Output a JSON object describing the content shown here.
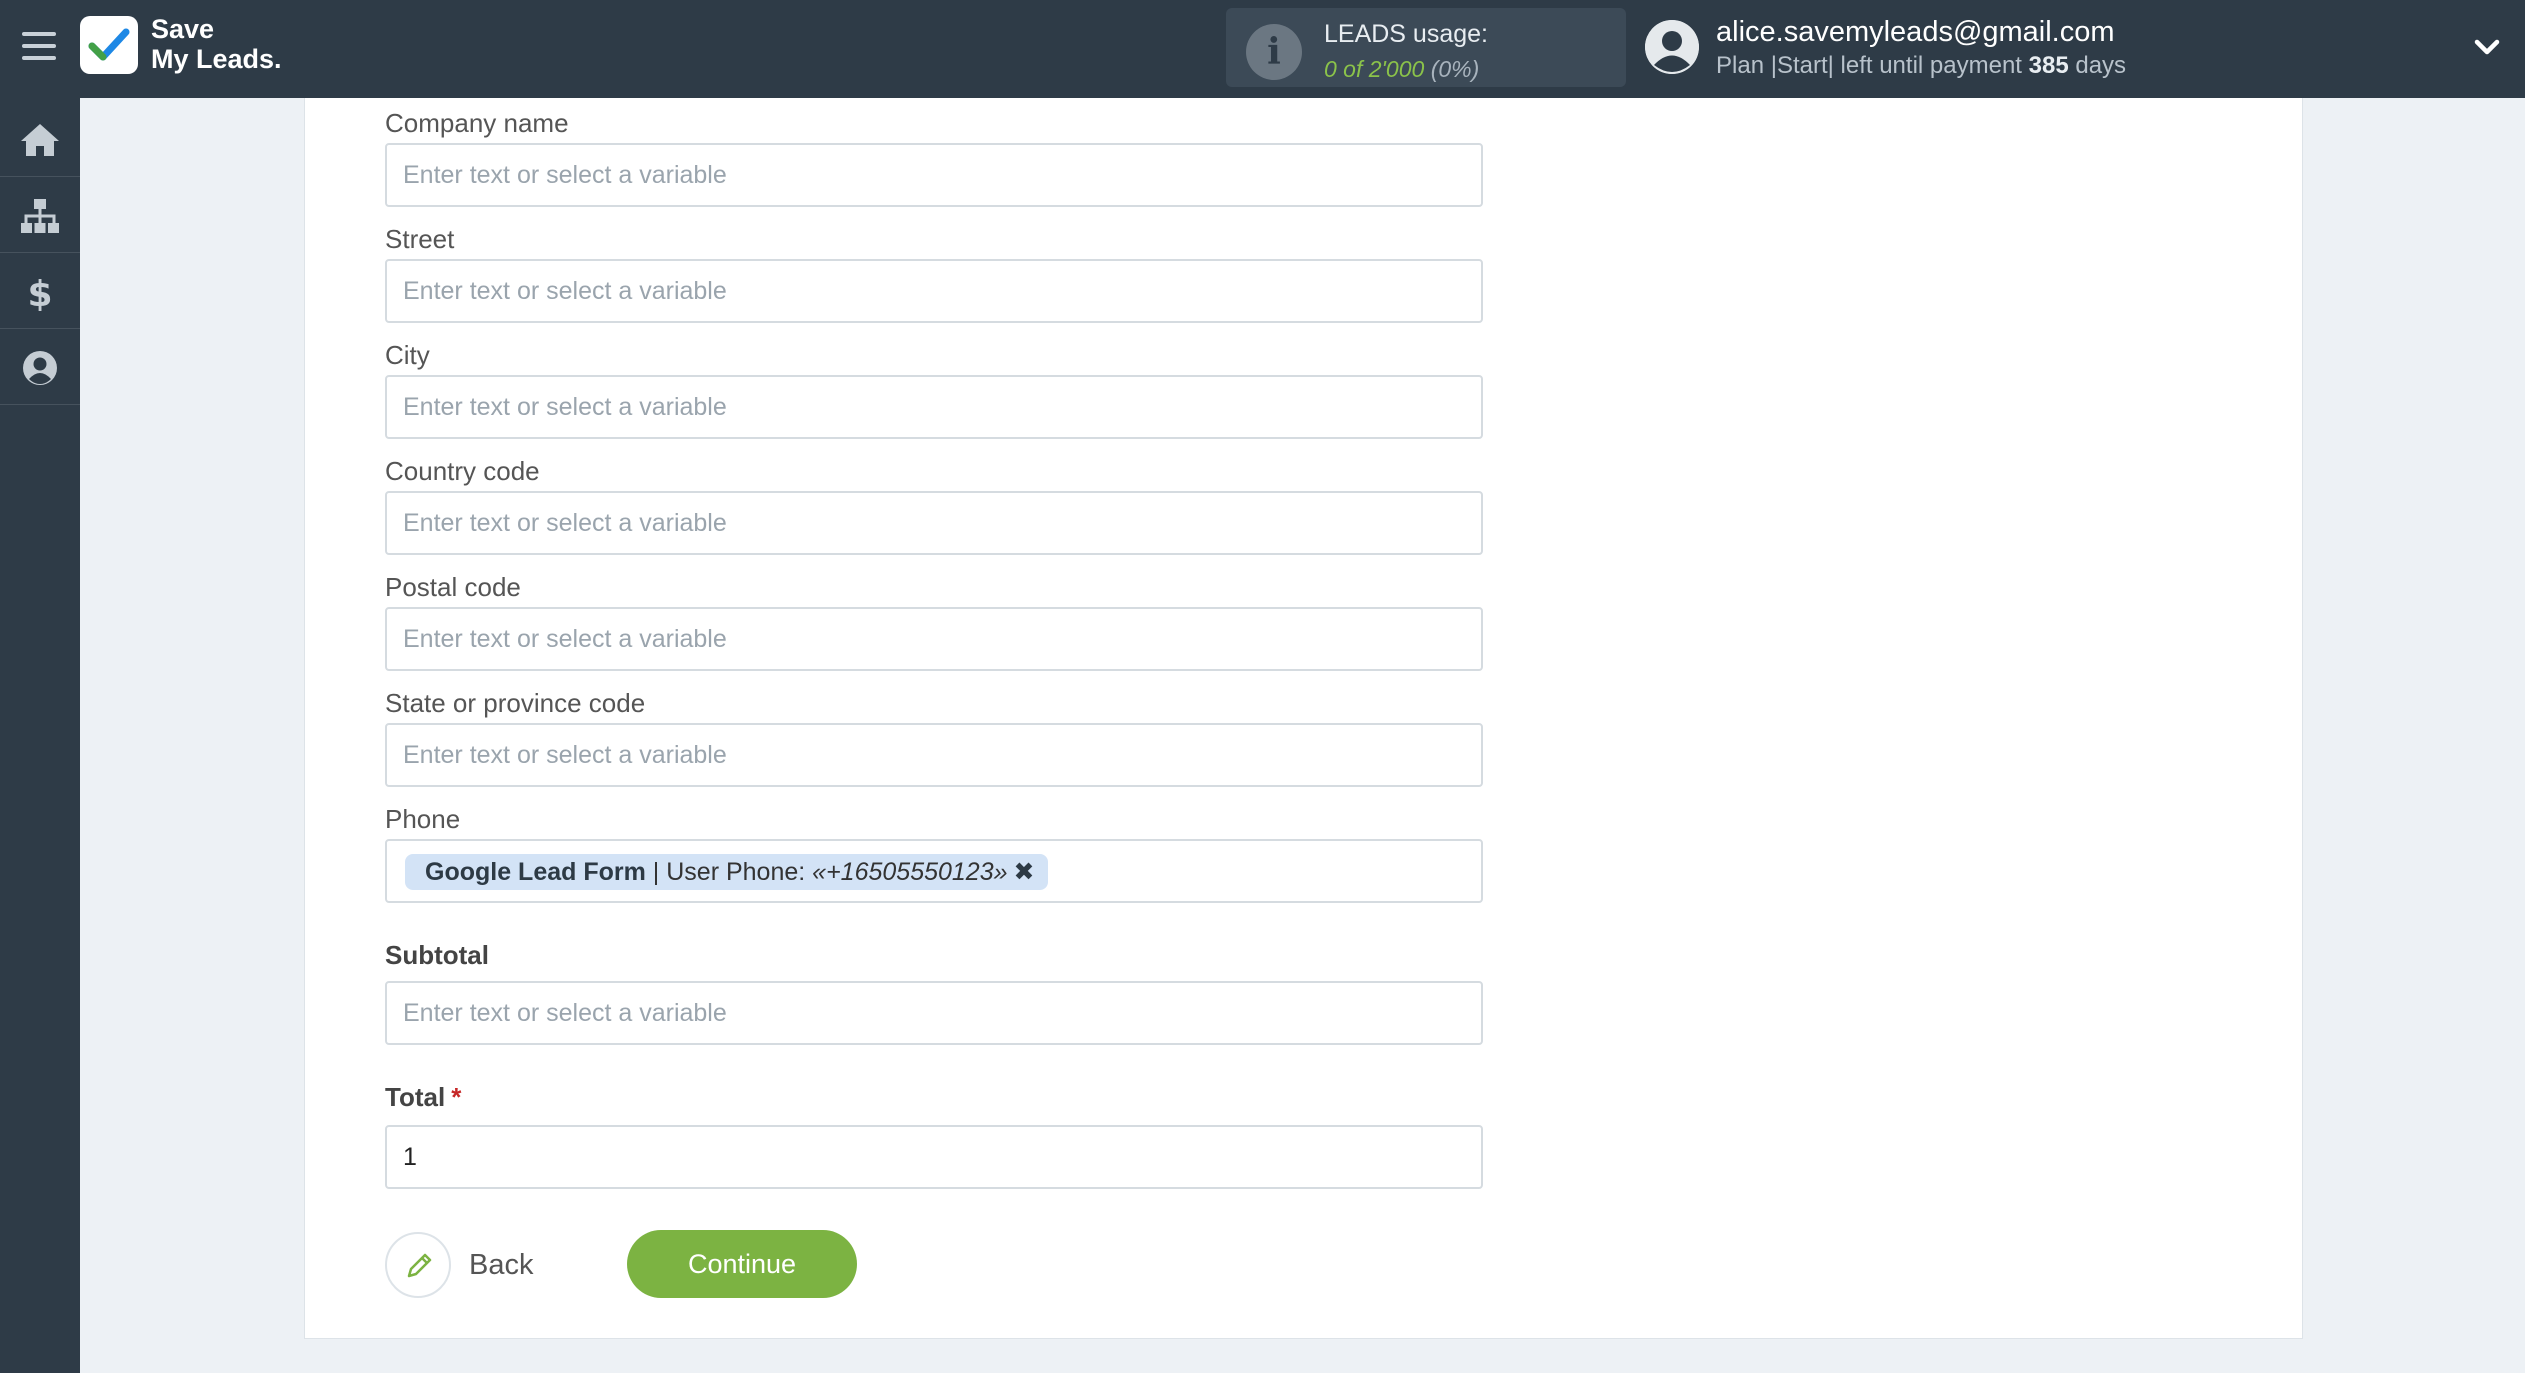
{
  "header": {
    "logo_line1": "Save",
    "logo_line2": "My Leads.",
    "usage_title": "LEADS usage:",
    "usage_value": "0 of 2'000",
    "usage_percent": "(0%)",
    "user_email": "alice.savemyleads@gmail.com",
    "plan_prefix": "Plan |Start| left until payment",
    "plan_days": "385",
    "plan_suffix": "days"
  },
  "sidebar": {
    "items": [
      {
        "icon": "home-icon"
      },
      {
        "icon": "sitemap-icon"
      },
      {
        "icon": "dollar-icon"
      },
      {
        "icon": "user-circle-icon"
      }
    ]
  },
  "form": {
    "placeholder": "Enter text or select a variable",
    "fields": [
      {
        "label": "Company name",
        "value": ""
      },
      {
        "label": "Street",
        "value": ""
      },
      {
        "label": "City",
        "value": ""
      },
      {
        "label": "Country code",
        "value": ""
      },
      {
        "label": "Postal code",
        "value": ""
      },
      {
        "label": "State or province code",
        "value": ""
      }
    ],
    "phone": {
      "label": "Phone",
      "tag_source": "Google Lead Form",
      "tag_separator": " | ",
      "tag_field": "User Phone:",
      "tag_value": "«+16505550123»",
      "tag_remove": "✖"
    },
    "subtotal": {
      "label": "Subtotal",
      "value": ""
    },
    "total": {
      "label": "Total",
      "required_mark": "*",
      "value": "1"
    }
  },
  "actions": {
    "back_label": "Back",
    "continue_label": "Continue"
  },
  "colors": {
    "topbar": "#2e3b47",
    "accent_green": "#7cb342",
    "tag_bg": "#d3e3f6"
  }
}
